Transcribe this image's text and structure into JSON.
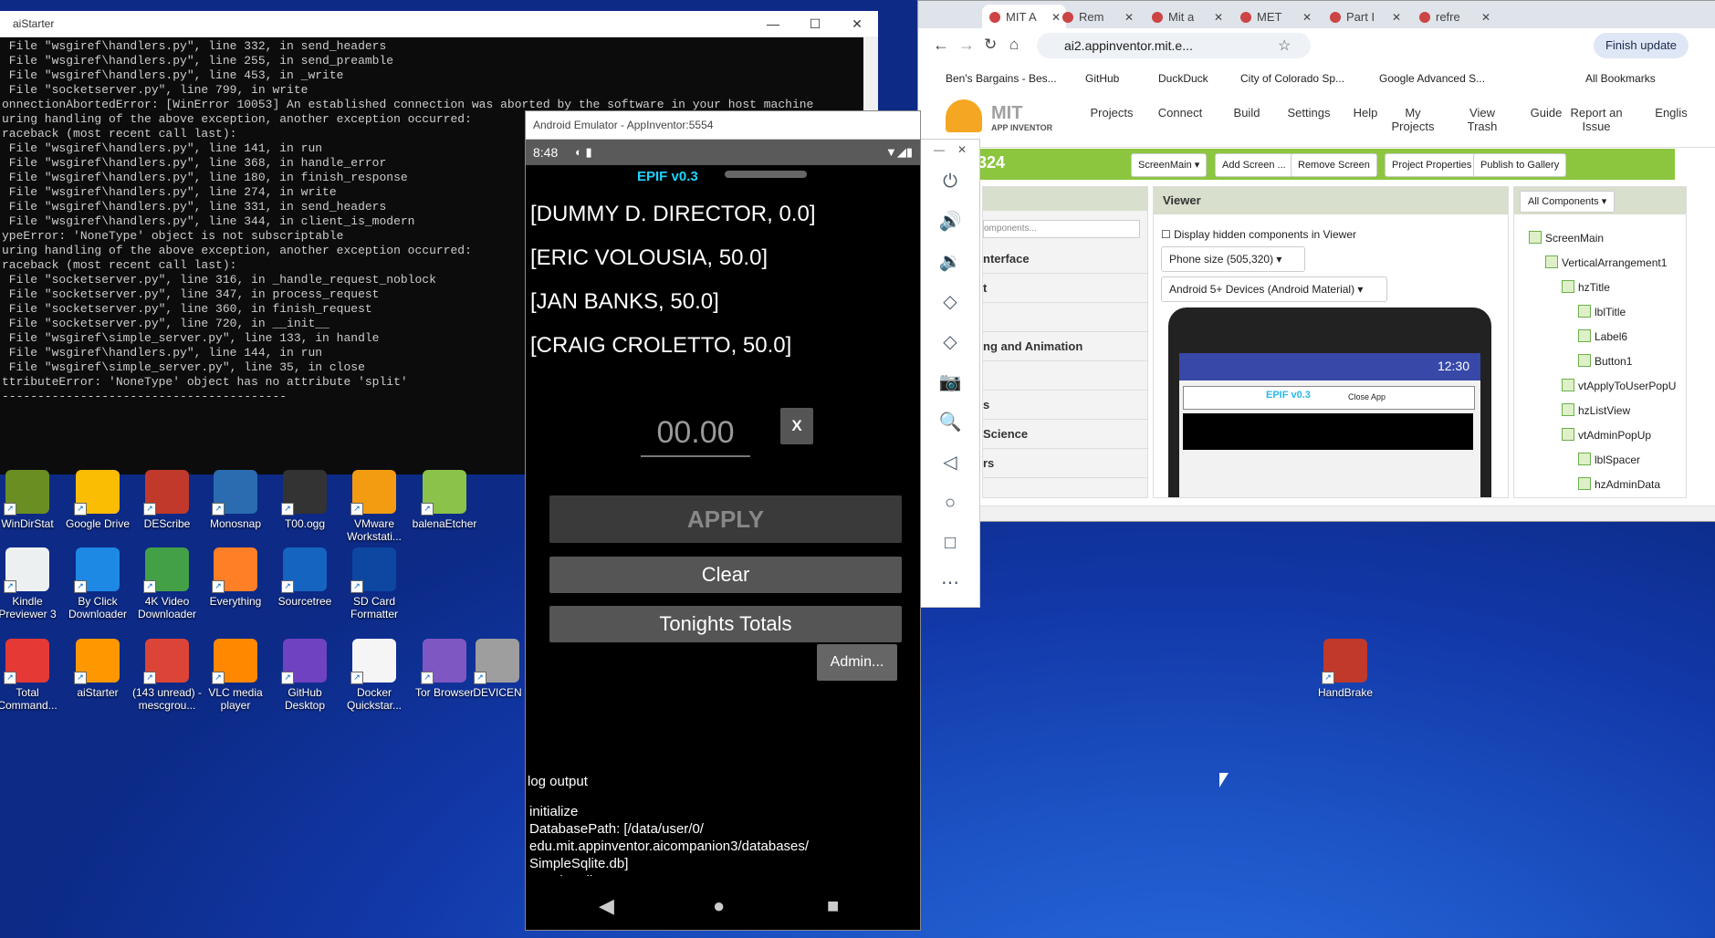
{
  "console": {
    "title": "aiStarter",
    "lines": [
      " File \"wsgiref\\handlers.py\", line 332, in send_headers",
      " File \"wsgiref\\handlers.py\", line 255, in send_preamble",
      " File \"wsgiref\\handlers.py\", line 453, in _write",
      " File \"socketserver.py\", line 799, in write",
      "onnectionAbortedError: [WinError 10053] An established connection was aborted by the software in your host machine",
      "",
      "uring handling of the above exception, another exception occurred:",
      "",
      "raceback (most recent call last):",
      " File \"wsgiref\\handlers.py\", line 141, in run",
      " File \"wsgiref\\handlers.py\", line 368, in handle_error",
      " File \"wsgiref\\handlers.py\", line 180, in finish_response",
      " File \"wsgiref\\handlers.py\", line 274, in write",
      " File \"wsgiref\\handlers.py\", line 331, in send_headers",
      " File \"wsgiref\\handlers.py\", line 344, in client_is_modern",
      "ypeError: 'NoneType' object is not subscriptable",
      "",
      "uring handling of the above exception, another exception occurred:",
      "",
      "raceback (most recent call last):",
      " File \"socketserver.py\", line 316, in _handle_request_noblock",
      " File \"socketserver.py\", line 347, in process_request",
      " File \"socketserver.py\", line 360, in finish_request",
      " File \"socketserver.py\", line 720, in __init__",
      " File \"wsgiref\\simple_server.py\", line 133, in handle",
      " File \"wsgiref\\handlers.py\", line 144, in run",
      " File \"wsgiref\\simple_server.py\", line 35, in close",
      "ttributeError: 'NoneType' object has no attribute 'split'",
      "----------------------------------------"
    ],
    "min": "—",
    "max": "☐",
    "close": "✕"
  },
  "desktop_icons": [
    {
      "label": "WinDirStat",
      "color": "#6b8e23"
    },
    {
      "label": "Google Drive",
      "color": "#fbbc04"
    },
    {
      "label": "DEScribe",
      "color": "#c0392b"
    },
    {
      "label": "Monosnap",
      "color": "#2b6cb0"
    },
    {
      "label": "T00.ogg",
      "color": "#333333"
    },
    {
      "label": "VMware Workstati...",
      "color": "#f39c12"
    },
    {
      "label": "balenaEtcher",
      "color": "#8bc34a"
    },
    {
      "label": "Kindle Previewer 3",
      "color": "#ecf0f1"
    },
    {
      "label": "By Click Downloader",
      "color": "#1e88e5"
    },
    {
      "label": "4K Video Downloader",
      "color": "#43a047"
    },
    {
      "label": "Everything",
      "color": "#ff7f27"
    },
    {
      "label": "Sourcetree",
      "color": "#1565c0"
    },
    {
      "label": "SD Card Formatter",
      "color": "#0d47a1"
    },
    {
      "label": "Total Command...",
      "color": "#e53935"
    },
    {
      "label": "aiStarter",
      "color": "#ff9800"
    },
    {
      "label": "(143 unread) - mescgrou...",
      "color": "#db4437"
    },
    {
      "label": "VLC media player",
      "color": "#ff8800"
    },
    {
      "label": "GitHub Desktop",
      "color": "#6f42c1"
    },
    {
      "label": "Docker Quickstar...",
      "color": "#f5f5f5"
    },
    {
      "label": "Tor Browser",
      "color": "#7e57c2"
    },
    {
      "label": "DEVICEN",
      "color": "#9e9e9e"
    },
    {
      "label": "HandBrake",
      "color": "#c0392b"
    }
  ],
  "emulator": {
    "title": "Android Emulator - AppInventor:5554",
    "time": "8:48",
    "app_title": "EPIF v0.3",
    "list": [
      "[DUMMY D. DIRECTOR, 0.0]",
      "[ERIC VOLOUSIA, 50.0]",
      "[JAN BANKS, 50.0]",
      "[CRAIG CROLETTO, 50.0]"
    ],
    "amount_placeholder": "00.00",
    "x_label": "X",
    "apply_label": "APPLY",
    "clear_label": "Clear",
    "totals_label": "Tonights Totals",
    "admin_label": "Admin...",
    "log_title": "log output",
    "log_lines": [
      "initialize",
      "DatabasePath: [/data/user/0/",
      "edu.mit.appinventor.aicompanion3/databases/",
      "SimpleSqlite.db]",
      "opening db"
    ]
  },
  "emulator_side": {
    "min": "—",
    "close": "✕",
    "icons": [
      "power-icon",
      "volume-up-icon",
      "volume-down-icon",
      "rotate-left-icon",
      "rotate-right-icon",
      "camera-icon",
      "zoom-icon",
      "back-icon",
      "home-icon",
      "overview-icon",
      "more-icon"
    ],
    "glyphs": [
      "⏻",
      "🔊",
      "🔉",
      "◇",
      "◇",
      "📷",
      "🔍",
      "◁",
      "○",
      "□",
      "⋯"
    ]
  },
  "chrome": {
    "tabs": [
      "MIT A",
      "Rem",
      "Mit a",
      "MET",
      "Part I",
      "refre"
    ],
    "url": "ai2.appinventor.mit.e...",
    "finish_update": "Finish update",
    "bookmarks": [
      "Ben's Bargains - Bes...",
      "GitHub",
      "DuckDuck",
      "City of Colorado Sp...",
      "Google Advanced S..."
    ],
    "all_bookmarks": "All Bookmarks",
    "logo_mit": "MIT",
    "logo_sub": "APP INVENTOR",
    "menu": [
      "Projects",
      "Connect",
      "Build",
      "Settings",
      "Help",
      "My Projects",
      "View Trash",
      "Guide",
      "Report an Issue",
      "Englis"
    ],
    "project_suffix": "324",
    "buttons": [
      "ScreenMain ▾",
      "Add Screen ...",
      "Remove Screen",
      "Project Properties",
      "Publish to Gallery"
    ],
    "palette_search": "omponents...",
    "palette_items": [
      "nterface",
      "t",
      "",
      "ng and Animation",
      "",
      "s",
      "Science",
      "rs"
    ],
    "viewer_title": "Viewer",
    "display_hidden": "Display hidden components in Viewer",
    "phone_size": "Phone size (505,320)",
    "device": "Android 5+ Devices (Android Material)",
    "preview_time": "12:30",
    "preview_title": "EPIF v0.3",
    "preview_close": "Close App",
    "all_components": "All Components ▾",
    "tree": [
      "ScreenMain",
      "VerticalArrangement1",
      "hzTitle",
      "lblTitle",
      "Label6",
      "Button1",
      "vtApplyToUserPopU",
      "hzListView",
      "vtAdminPopUp",
      "lblSpacer",
      "hzAdminData"
    ]
  }
}
